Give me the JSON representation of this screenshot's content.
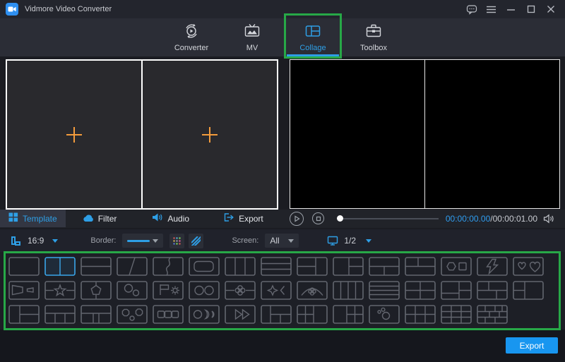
{
  "titlebar": {
    "app_title": "Vidmore Video Converter"
  },
  "window_controls": {
    "icons": [
      "feedback-icon",
      "menu-icon",
      "minimize-icon",
      "maximize-icon",
      "close-icon"
    ]
  },
  "nav": {
    "tabs": [
      {
        "label": "Converter",
        "icon": "converter-icon",
        "active": false
      },
      {
        "label": "MV",
        "icon": "mv-icon",
        "active": false
      },
      {
        "label": "Collage",
        "icon": "collage-icon",
        "active": true
      },
      {
        "label": "Toolbox",
        "icon": "toolbox-icon",
        "active": false
      }
    ]
  },
  "editor": {
    "cells": [
      {
        "icon": "add-plus-icon"
      },
      {
        "icon": "add-plus-icon"
      }
    ]
  },
  "panel_tabs": [
    {
      "label": "Template",
      "icon": "template-icon",
      "active": true
    },
    {
      "label": "Filter",
      "icon": "filter-cloud-icon",
      "active": false
    },
    {
      "label": "Audio",
      "icon": "audio-speaker-icon",
      "active": false
    },
    {
      "label": "Export",
      "icon": "export-arrow-icon",
      "active": false
    }
  ],
  "player": {
    "icons": [
      "play-icon",
      "stop-icon",
      "volume-icon"
    ],
    "current_time": "00:00:00.00",
    "separator": "/",
    "total_time": "00:00:01.00",
    "progress_percent": 0
  },
  "toolbar": {
    "ratio_icon": "aspect-ratio-icon",
    "ratio_value": "16:9",
    "border_label": "Border:",
    "border_style_icons": [
      "border-color-dots-icon",
      "border-pattern-stripes-icon"
    ],
    "screen_label": "Screen:",
    "screen_value": "All",
    "screen_icon": "monitor-icon",
    "page_indicator": "1/2"
  },
  "templates": {
    "selected_index": [
      0,
      1
    ],
    "rows": [
      [
        "single",
        "two-vertical",
        "two-horizontal",
        "diagonal-split",
        "wave-split",
        "rounded-frame",
        "three-columns",
        "three-rows",
        "left-two-rows-right",
        "left-right-two-rows",
        "top-bottom-two-cols",
        "top-two-cols-bottom",
        "hexagon-square",
        "lightning",
        "hearts"
      ],
      [
        "trapezoids",
        "star-banner",
        "pentagon",
        "two-circles-diagonal",
        "flag-gear",
        "two-circles",
        "clover-banner",
        "sparkle-bracket",
        "arch-flower",
        "four-columns",
        "four-rows",
        "grid-2x2",
        "grid-2x2-offset",
        "bricks-offset",
        "left-two-rows-right-big"
      ],
      [
        "left-narrow-right-two-rows",
        "top-bottom-three-cols",
        "top-bottom-middle-split",
        "octagons-dot",
        "three-squares",
        "circle-crescents",
        "two-triangles",
        "grid-narrow-left",
        "grid-2x2-right-big",
        "grid-left-big-2x2",
        "dots-circle",
        "grid-3x2",
        "grid-3x3",
        "grid-bricks"
      ]
    ]
  },
  "footer": {
    "export_label": "Export"
  },
  "colors": {
    "accent_blue": "#2e9fe6",
    "plus_orange": "#f39b3c",
    "annotation_green": "#27a847",
    "export_blue": "#1896f0",
    "time_blue": "#2f9df0"
  }
}
